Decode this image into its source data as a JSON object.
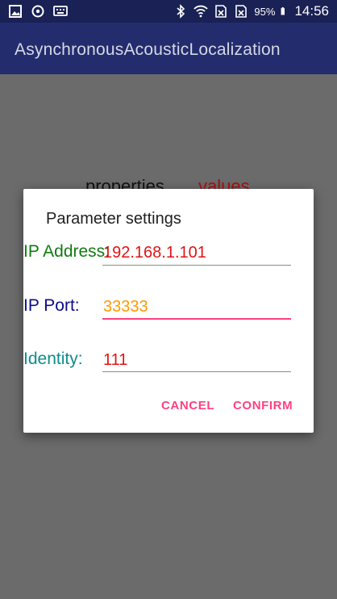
{
  "status_bar": {
    "battery": "95%",
    "time": "14:56",
    "icons": [
      "image-icon",
      "sync-icon",
      "keyboard-icon",
      "bluetooth-icon",
      "wifi-icon",
      "no-sim-icon",
      "no-sim-icon",
      "battery-icon"
    ]
  },
  "app": {
    "title": "AsynchronousAcousticLocalization"
  },
  "background_table": {
    "properties_header": "properties",
    "values_header": "values"
  },
  "dialog": {
    "title": "Parameter settings",
    "fields": [
      {
        "label": "IP Address:",
        "value": "192.168.1.101"
      },
      {
        "label": "IP Port:",
        "value": "33333"
      },
      {
        "label": "Identity:",
        "value": "111"
      }
    ],
    "cancel_label": "CANCEL",
    "confirm_label": "CONFIRM"
  },
  "colors": {
    "app_bar": "#232c6d",
    "status_bar": "#1a2155",
    "accent": "#ff4081",
    "ip_label": "#117a11",
    "port_label": "#0d0d8a",
    "identity_label": "#118a8a",
    "value_red": "#e01414",
    "value_orange": "#ff9800"
  }
}
